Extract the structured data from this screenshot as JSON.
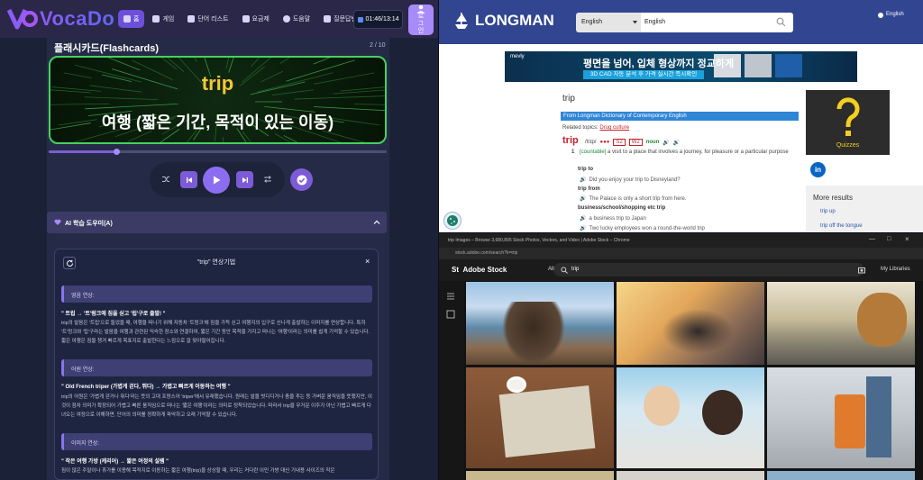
{
  "left_app": {
    "logo_text": "VocaDo",
    "nav": [
      {
        "label": "홈",
        "icon": "home-icon",
        "active": true
      },
      {
        "label": "게임",
        "icon": "gamepad-icon",
        "active": false
      },
      {
        "label": "단어 리스트",
        "icon": "list-icon",
        "active": false
      },
      {
        "label": "요금제",
        "icon": "card-icon",
        "active": false
      },
      {
        "label": "도움말",
        "icon": "help-icon",
        "active": false
      },
      {
        "label": "질문답변",
        "icon": "chat-icon",
        "active": false
      }
    ],
    "timer": "01:46/13:14",
    "user_label": "로그인",
    "flashcards_title": "플래시카드(Flashcards)",
    "card_counter": "2 / 10",
    "card_word": "trip",
    "card_meaning": "여행 (짧은 기간, 목적이 있는 이동)",
    "progress_fraction": 0.2,
    "ai_helper_title": "AI 학습 도우미(A)",
    "ai_panel_title": "\"trip\" 연상기법",
    "sections": [
      {
        "heading": "영음 연상:",
        "subheading": "\" 트립 → '트'럼크에 짐을 싣고 '립'구로 출발! \"",
        "text": "trip의 발음은 '트립'으로 들었을 때, 여행을 떠나기 위해 자동차 '트렁크'에 짐을 가득 싣고 여행지의 입구로 신나게 출발하는 이미지를 연상합니다. 특히 '트'렁크와 '립'구라는 발음을 여행과 관련된 익숙한 장소와 연결하여, 짧은 기간 동안 목적을 가지고 떠나는 '여행'이라는 의미를 쉽게 기억할 수 있습니다. 짧은 여행은 짐을 챙겨 빠르게 목표지로 출발한다는 느낌으로 잘 맞아떨어집니다."
      },
      {
        "heading": "어원 연상:",
        "subheading": "\" Old French triper (가볍게 걷다, 뛰다) → 가볍고 빠르게 이동하는 여행 \"",
        "text": "trip의 어원은 '가볍게 걷거나 뛰다'라는 뜻의 고대 프랑스어 'triper'에서 유래했습니다. 원래는 발을 빗디디거나 춤을 추는 등 가벼운 움직임을 뜻했지만, 이것이 점차 의미가 확장되어 가볍고 빠른 움직임으로 떠나는 '짧은 여행'이라는 의미로 정착되었습니다. 따라서 trip을 무거운 이주가 아닌 가볍고 빠르게 다녀오는 여정으로 이해하면, 단어의 의미를 정확하게 파악하고 오래 기억할 수 있습니다."
      },
      {
        "heading": "이미지 연상:",
        "subheading": "\" 작은 여행 가방 (캐리어) → 짧은 여정의 설렘 \"",
        "text": "짐이 많은 주말이나 휴가를 이용해 목적지로 이동하는 짧은 여행(trip)을 상상할 때, 우리는 커다란 이민 가방 대신 기내용 사이즈의 작은"
      }
    ]
  },
  "longman": {
    "logo": "LONGMAN",
    "language_select": "English",
    "search_value": "English",
    "lang_link": "English",
    "ad_line1": "평면을 넘어, 입체 형상까지 정교하게",
    "ad_line2": "3D CAD 자동 분석 후 가격 실시간 즉시확인",
    "ad_brand": "mevly",
    "entry_word": "trip",
    "dict_bar": "From Longman Dictionary of Contemporary English",
    "related_label": "Related topics:",
    "related_topic": "Drug culture",
    "headword": "trip",
    "pron": "/trɪp/",
    "freq": "●●●",
    "badge_s2": "S2",
    "badge_w2": "W2",
    "pos": "noun",
    "sense_no": "1",
    "sense_tag": "[countable]",
    "sense_def": "a visit to a place that involves a journey, for pleasure or a particular purpose",
    "colloc1": "trip to",
    "ex1": "Did you enjoy your trip to Disneyland?",
    "colloc2": "trip from",
    "ex2": "The Palace is only a short trip from here.",
    "colloc3": "business/school/shopping etc trip",
    "ex3": "a business trip to Japan",
    "ex4": "Two lucky employees won a round-the-world trip",
    "quiz_label": "Quizzes",
    "more_results_title": "More results",
    "more_results": [
      "trip up",
      "trip off the tongue"
    ]
  },
  "adobe": {
    "window_title": "trip Images – Browse 3,680,895 Stock Photos, Vectors, and Video | Adobe Stock – Chrome",
    "url": "stock.adobe.com/search?k=trip",
    "logo": "Adobe Stock",
    "filter": "All",
    "query": "trip",
    "libraries": "My Libraries"
  }
}
